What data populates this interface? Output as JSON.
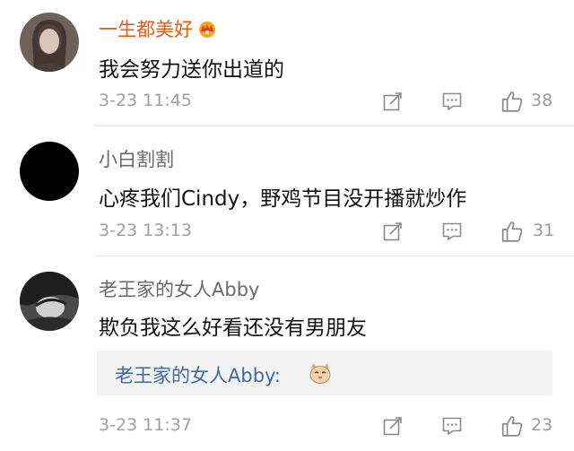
{
  "colors": {
    "vip_name": "#e8590c",
    "username": "#6a6a6a",
    "text": "#111111",
    "meta": "#a0a0a0",
    "reply_link": "#3d6aa5",
    "reply_bg": "#f3f3f3"
  },
  "comments": [
    {
      "username": "一生都美好",
      "badge_icon": "crown-badge-icon",
      "text": "我会努力送你出道的",
      "time": "3-23 11:45",
      "likes": "38"
    },
    {
      "username": "小白割割",
      "text": "心疼我们Cindy，野鸡节目没开播就炒作",
      "time": "3-23 13:13",
      "likes": "31"
    },
    {
      "username": "老王家的女人Abby",
      "text": "欺负我这么好看还没有男朋友",
      "reply": {
        "author": "老王家的女人Abby:",
        "emoji_icon": "cat-face-emoji-icon"
      },
      "time": "3-23 11:37",
      "likes": "23"
    }
  ],
  "actions": {
    "repost_icon": "edit-share-icon",
    "comment_icon": "comment-icon",
    "like_icon": "thumbs-up-icon"
  }
}
